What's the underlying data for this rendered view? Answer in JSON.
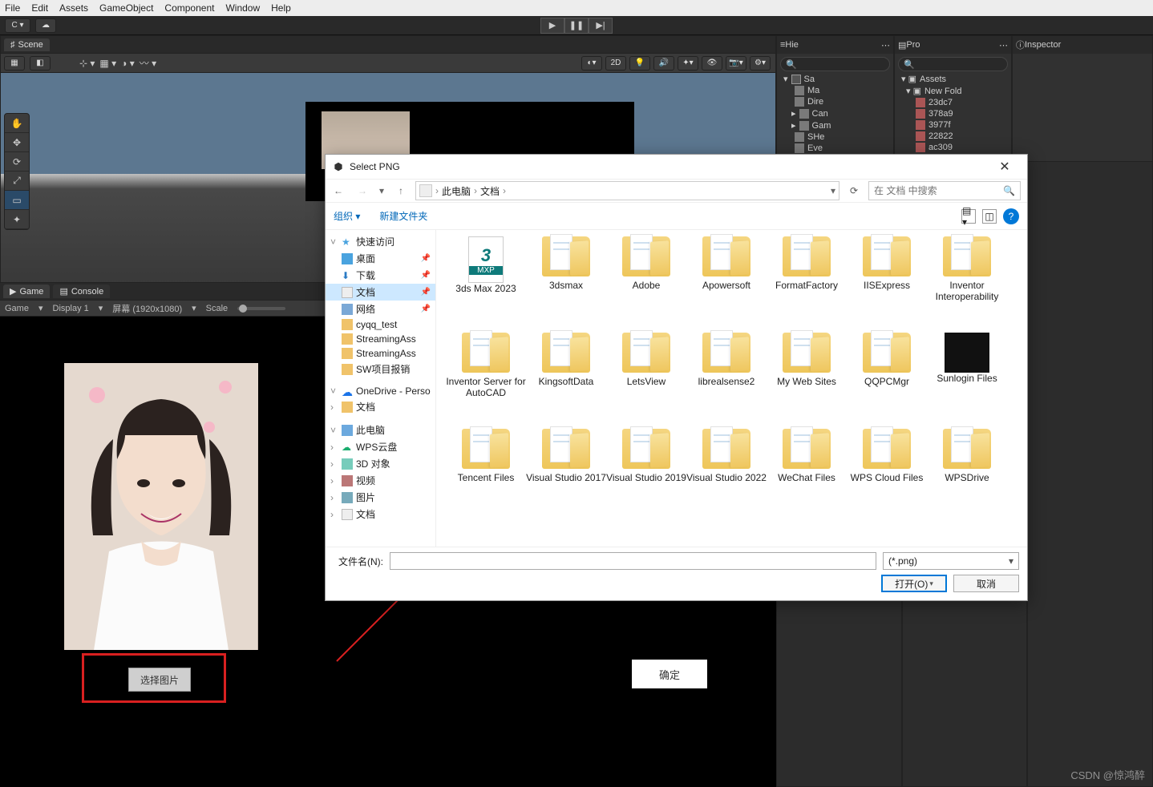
{
  "menubar": [
    "File",
    "Edit",
    "Assets",
    "GameObject",
    "Component",
    "Window",
    "Help"
  ],
  "toolbar": {
    "account": "C ▾",
    "cloud": "☁"
  },
  "play": {
    "play": "▶",
    "pause": "❚❚",
    "step": "▶|"
  },
  "tab_scene": "Scene",
  "tab_game": "Game",
  "tab_console": "Console",
  "scene_bar": {
    "mode": "2D"
  },
  "game_bar": {
    "game": "Game",
    "display": "Display 1",
    "aspect": "屏幕 (1920x1080)",
    "scale": "Scale"
  },
  "hierarchy": {
    "tab": "Hie",
    "scene": "Sa",
    "items": [
      "Ma",
      "Dire",
      "Can",
      "Gam",
      "SHe",
      "Eve"
    ]
  },
  "project": {
    "tab": "Pro",
    "root": "Assets",
    "folder": "New Fold",
    "items": [
      "23dc7",
      "378a9",
      "3977f",
      "22822",
      "ac309"
    ]
  },
  "inspector": {
    "tab": "Inspector"
  },
  "game_buttons": {
    "select": "选择图片",
    "ok": "确定"
  },
  "dialog": {
    "title": "Select PNG",
    "breadcrumb": {
      "pc": "此电脑",
      "docs": "文档"
    },
    "search_placeholder": "在 文档 中搜索",
    "organize": "组织 ▾",
    "newfolder": "新建文件夹",
    "sidebar": {
      "quick": "快速访问",
      "desktop": "桌面",
      "downloads": "下载",
      "documents": "文档",
      "network": "网络",
      "folders": [
        "cyqq_test",
        "StreamingAss",
        "StreamingAss",
        "SW项目报销"
      ],
      "onedrive": "OneDrive - Perso",
      "od_docs": "文档",
      "thispc": "此电脑",
      "wps": "WPS云盘",
      "obj3d": "3D 对象",
      "videos": "视频",
      "pictures": "图片",
      "docs2": "文档"
    },
    "folders_grid": [
      "3ds Max 2023",
      "3dsmax",
      "Adobe",
      "Apowersoft",
      "FormatFactory",
      "IISExpress",
      "Inventor Interoperability",
      "Inventor Server for AutoCAD",
      "KingsoftData",
      "LetsView",
      "librealsense2",
      "My Web Sites",
      "QQPCMgr",
      "Sunlogin Files",
      "Tencent Files",
      "Visual Studio 2017",
      "Visual Studio 2019",
      "Visual Studio 2022",
      "WeChat Files",
      "WPS Cloud Files",
      "WPSDrive"
    ],
    "mxp_label": "MXP",
    "filename_label": "文件名(N):",
    "filter": "(*.png)",
    "open": "打开(O)",
    "cancel": "取消"
  },
  "watermark": "CSDN @惊鸿醉"
}
